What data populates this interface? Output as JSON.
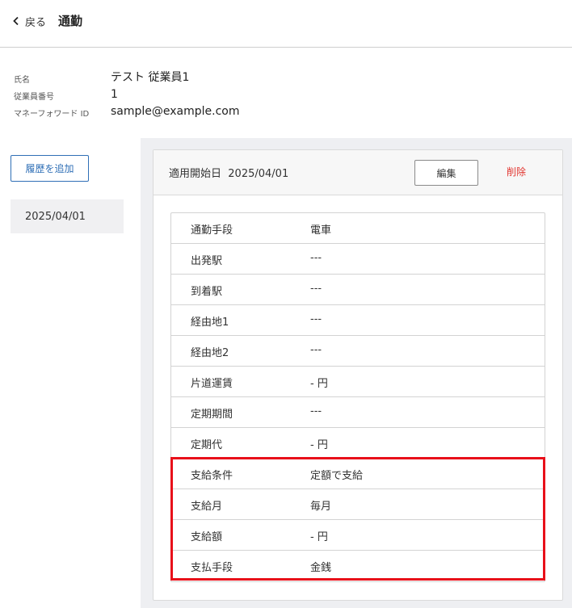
{
  "header": {
    "back_label": "戻る",
    "title": "通勤"
  },
  "employee": {
    "fields": [
      {
        "label": "氏名",
        "value": "テスト 従業員1"
      },
      {
        "label": "従業員番号",
        "value": "1"
      },
      {
        "label": "マネーフォワード ID",
        "value": "sample@example.com"
      }
    ]
  },
  "sidebar": {
    "add_history_label": "履歴を追加",
    "history_items": [
      "2025/04/01"
    ]
  },
  "record": {
    "start_date_label": "適用開始日",
    "start_date": "2025/04/01",
    "edit_label": "編集",
    "delete_label": "削除",
    "rows": [
      {
        "label": "通勤手段",
        "value": "電車"
      },
      {
        "label": "出発駅",
        "value": "---"
      },
      {
        "label": "到着駅",
        "value": "---"
      },
      {
        "label": "経由地1",
        "value": "---"
      },
      {
        "label": "経由地2",
        "value": "---"
      },
      {
        "label": "片道運賃",
        "value": "- 円"
      },
      {
        "label": "定期期間",
        "value": "---"
      },
      {
        "label": "定期代",
        "value": "- 円"
      },
      {
        "label": "支給条件",
        "value": "定額で支給"
      },
      {
        "label": "支給月",
        "value": "毎月"
      },
      {
        "label": "支給額",
        "value": "- 円"
      },
      {
        "label": "支払手段",
        "value": "金銭"
      }
    ]
  },
  "colors": {
    "accent": "#2f6fb6",
    "danger": "#e2352f",
    "highlight": "#e8101a",
    "panel_bg": "#eeeff2"
  },
  "icons": {
    "back": "chevron-left-icon"
  }
}
